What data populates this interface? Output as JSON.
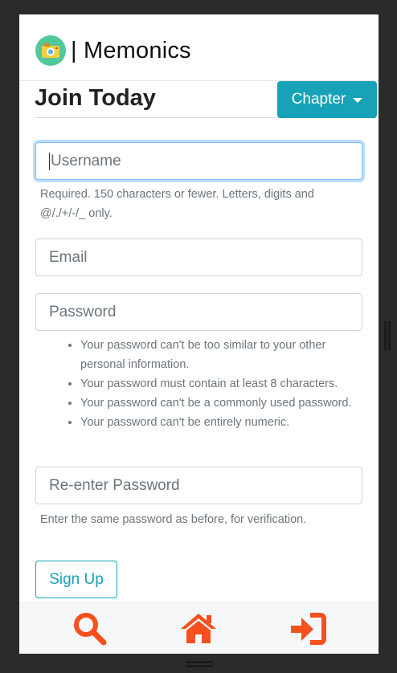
{
  "brand": {
    "name": "| Memonics",
    "logo_icon": "camera-icon",
    "logo_color": "#52c89a"
  },
  "page": {
    "title": "Join Today"
  },
  "chapter_dropdown": {
    "label": "Chapter",
    "color": "#17a2b8"
  },
  "form": {
    "username": {
      "placeholder": "Username",
      "help": "Required. 150 characters or fewer. Letters, digits and @/./+/-/_ only."
    },
    "email": {
      "placeholder": "Email"
    },
    "password": {
      "placeholder": "Password",
      "rules": [
        "Your password can't be too similar to your other personal information.",
        "Your password must contain at least 8 characters.",
        "Your password can't be a commonly used password.",
        "Your password can't be entirely numeric."
      ]
    },
    "password_confirm": {
      "placeholder": "Re-enter Password",
      "help": "Enter the same password as before, for verification."
    },
    "submit_label": "Sign Up"
  },
  "bottom_nav": {
    "items": [
      {
        "icon": "search-icon"
      },
      {
        "icon": "home-icon"
      },
      {
        "icon": "sign-in-icon"
      }
    ],
    "icon_color": "#f4511e"
  }
}
